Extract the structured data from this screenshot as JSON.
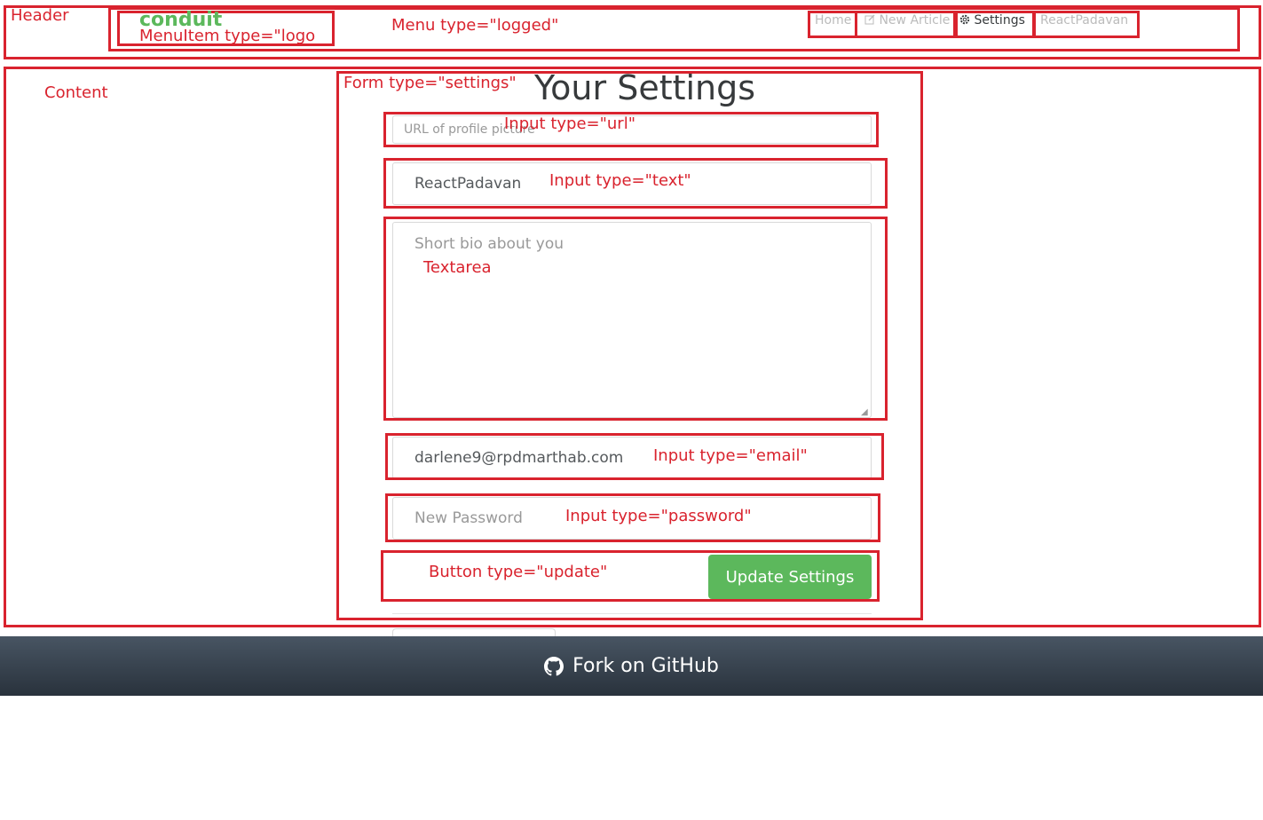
{
  "annotations": {
    "header": "Header",
    "menu_item_logo": "MenuItem type=\"logo",
    "menu_logged": "Menu type=\"logged\"",
    "content": "Content",
    "form_settings": "Form type=\"settings\"",
    "input_url": "Input type=\"url\"",
    "input_text": "Input type=\"text\"",
    "textarea": "Textarea",
    "input_email": "Input type=\"email\"",
    "input_password": "Input type=\"password\"",
    "button_update": "Button type=\"update\""
  },
  "brand": {
    "logo": "conduit",
    "color": "#5cb85c"
  },
  "nav": {
    "home": "Home",
    "new_article": "New Article",
    "settings": "Settings",
    "user": "ReactPadavan",
    "icons": {
      "new_article": "edit-icon",
      "settings": "gear-icon"
    }
  },
  "settings_form": {
    "title": "Your Settings",
    "image_placeholder": "URL of profile picture",
    "username_value": "ReactPadavan",
    "bio_placeholder": "Short bio about you",
    "email_value": "darlene9@rpdmarthab.com",
    "password_placeholder": "New Password",
    "submit_label": "Update Settings"
  },
  "footer": {
    "label": "Fork on GitHub",
    "icon": "github-icon"
  },
  "colors": {
    "annotation": "#d9232e",
    "accent": "#5cb85c"
  }
}
